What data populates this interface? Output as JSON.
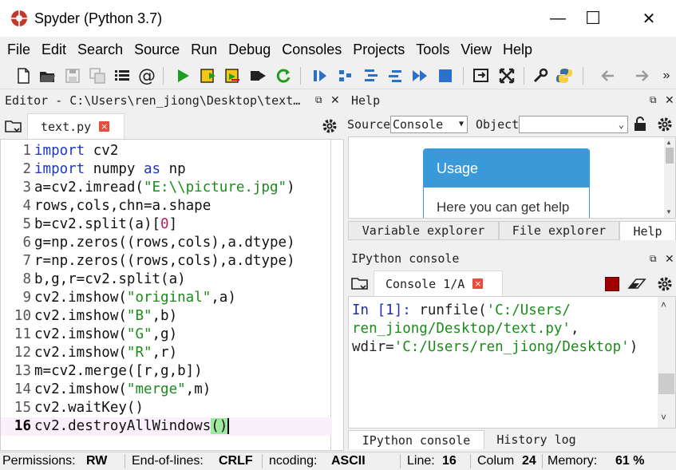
{
  "window": {
    "title": "Spyder (Python 3.7)",
    "minimize": "—",
    "maximize": "☐",
    "close": "✕"
  },
  "menu": [
    "File",
    "Edit",
    "Search",
    "Source",
    "Run",
    "Debug",
    "Consoles",
    "Projects",
    "Tools",
    "View",
    "Help"
  ],
  "toolbar": {
    "icons": [
      "new-file-icon",
      "open-file-icon",
      "save-icon",
      "save-all-icon",
      "outline-icon",
      "at-icon",
      "run-icon",
      "run-cell-icon",
      "run-cell-advance-icon",
      "run-selection-icon",
      "rerun-icon",
      "debug-icon",
      "step-icon",
      "step-into-icon",
      "step-return-icon",
      "continue-icon",
      "stop-icon",
      "maximize-pane-icon",
      "fullscreen-icon",
      "tools-icon",
      "python-path-icon",
      "back-icon",
      "forward-icon",
      "more-icon"
    ],
    "more_label": "»"
  },
  "editor": {
    "header": "Editor - C:\\Users\\ren_jiong\\Desktop\\text…",
    "tab_label": "text.py",
    "current_line": 16,
    "lines": [
      [
        {
          "t": "import",
          "c": "kw"
        },
        {
          "t": " cv2",
          "c": "code"
        }
      ],
      [
        {
          "t": "import",
          "c": "kw"
        },
        {
          "t": " numpy ",
          "c": "code"
        },
        {
          "t": "as",
          "c": "kw"
        },
        {
          "t": " np",
          "c": "code"
        }
      ],
      [
        {
          "t": "a=cv2.imread(",
          "c": "code"
        },
        {
          "t": "\"E:\\\\picture.jpg\"",
          "c": "str"
        },
        {
          "t": ")",
          "c": "code"
        }
      ],
      [
        {
          "t": "rows,cols,chn=a.shape",
          "c": "code"
        }
      ],
      [
        {
          "t": "b=cv2.split(a)[",
          "c": "code"
        },
        {
          "t": "0",
          "c": "num"
        },
        {
          "t": "]",
          "c": "code"
        }
      ],
      [
        {
          "t": "g=np.zeros((rows,cols),a.dtype)",
          "c": "code"
        }
      ],
      [
        {
          "t": "r=np.zeros((rows,cols),a.dtype)",
          "c": "code"
        }
      ],
      [
        {
          "t": "b,g,r=cv2.split(a)",
          "c": "code"
        }
      ],
      [
        {
          "t": "cv2.imshow(",
          "c": "code"
        },
        {
          "t": "\"original\"",
          "c": "str"
        },
        {
          "t": ",a)",
          "c": "code"
        }
      ],
      [
        {
          "t": "cv2.imshow(",
          "c": "code"
        },
        {
          "t": "\"B\"",
          "c": "str"
        },
        {
          "t": ",b)",
          "c": "code"
        }
      ],
      [
        {
          "t": "cv2.imshow(",
          "c": "code"
        },
        {
          "t": "\"G\"",
          "c": "str"
        },
        {
          "t": ",g)",
          "c": "code"
        }
      ],
      [
        {
          "t": "cv2.imshow(",
          "c": "code"
        },
        {
          "t": "\"R\"",
          "c": "str"
        },
        {
          "t": ",r)",
          "c": "code"
        }
      ],
      [
        {
          "t": "m=cv2.merge([r,g,b])",
          "c": "code"
        }
      ],
      [
        {
          "t": "cv2.imshow(",
          "c": "code"
        },
        {
          "t": "\"merge\"",
          "c": "str"
        },
        {
          "t": ",m)",
          "c": "code"
        }
      ],
      [
        {
          "t": "cv2.waitKey()",
          "c": "code"
        }
      ],
      [
        {
          "t": "cv2.destroyAllWindows",
          "c": "code"
        },
        {
          "t": "()",
          "c": "code"
        }
      ]
    ]
  },
  "help": {
    "header": "Help",
    "source_label": "Source",
    "source_value": "Console",
    "object_label": "Object",
    "object_value": "",
    "usage_title": "Usage",
    "usage_text": "Here you can get help",
    "tabs": [
      "Variable explorer",
      "File explorer",
      "Help"
    ],
    "active_tab": "Help"
  },
  "console": {
    "header": "IPython console",
    "tab_label": "Console 1/A",
    "lines": [
      [
        {
          "t": "In [",
          "c": "cprompt"
        },
        {
          "t": "1",
          "c": "cprompt"
        },
        {
          "t": "]: ",
          "c": "cprompt"
        },
        {
          "t": "runfile(",
          "c": "cfn"
        },
        {
          "t": "'C:/Users/",
          "c": "cstr"
        }
      ],
      [
        {
          "t": "ren_jiong/Desktop/text.py'",
          "c": "cstr"
        },
        {
          "t": ",",
          "c": "cfn"
        }
      ],
      [
        {
          "t": "wdir=",
          "c": "cfn"
        },
        {
          "t": "'C:/Users/ren_jiong/Desktop'",
          "c": "cstr"
        },
        {
          "t": ")",
          "c": "cfn"
        }
      ]
    ],
    "tabs": [
      "IPython console",
      "History log"
    ],
    "active_tab": "IPython console"
  },
  "status": {
    "permissions_label": "Permissions:",
    "permissions_value": "RW",
    "eol_label": "End-of-lines:",
    "eol_value": "CRLF",
    "encoding_label": "ncoding:",
    "encoding_value": "ASCII",
    "line_label": "Line:",
    "line_value": "16",
    "column_label": "Colum",
    "column_value": "24",
    "memory_label": "Memory:",
    "memory_value": "61 %"
  },
  "colors": {
    "accent": "#3a9ad9",
    "run_green": "#1e9e1e",
    "stop_red": "#a00000",
    "close_tab": "#e74c3c"
  }
}
